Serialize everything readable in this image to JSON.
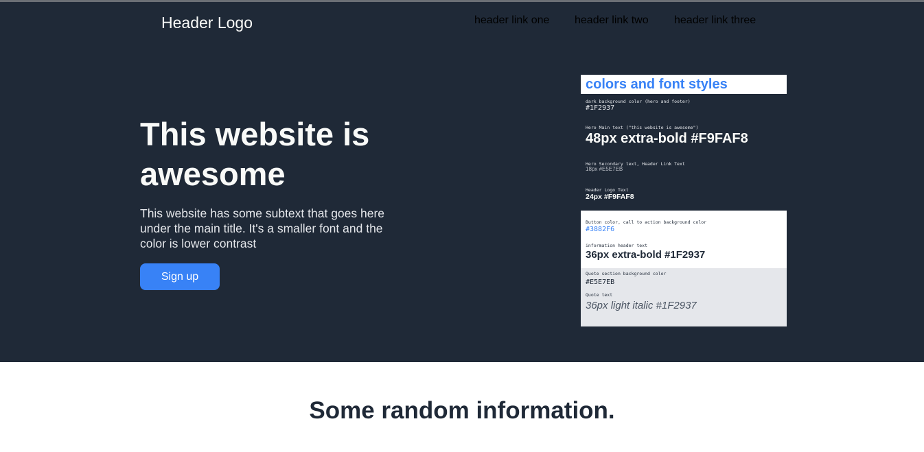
{
  "header": {
    "logo": "Header Logo",
    "links": [
      "header link one",
      "header link two",
      "header link three"
    ]
  },
  "hero": {
    "title": "This website is awesome",
    "subtitle": "This website has some subtext that goes here under the main title. It's a smaller font and the color is lower contrast",
    "cta_label": "Sign up"
  },
  "style_guide": {
    "title": "colors and font styles",
    "items": [
      {
        "label": "dark background color (hero and footer)",
        "value": "#1F2937"
      },
      {
        "label": "Hero Main text (\"this website is awesome\")",
        "value": "48px extra-bold #F9FAF8"
      },
      {
        "label": "Hero Secondary text, Header Link Text",
        "value": "18px #E5E7EB"
      },
      {
        "label": "Header Logo Text",
        "value": "24px #F9FAF8"
      },
      {
        "label": "Button color, call to action background color",
        "value": "#3882F6"
      },
      {
        "label": "information header text",
        "value": "36px extra-bold #1F2937"
      },
      {
        "label": "Quote section background color",
        "value": "#E5E7EB"
      },
      {
        "label": "Quote text",
        "value": "36px light italic #1F2937"
      }
    ]
  },
  "info": {
    "title": "Some random information."
  },
  "colors": {
    "dark_bg": "#1F2937",
    "accent": "#3882F6",
    "hero_text": "#F9FAF8",
    "secondary_text": "#E5E7EB"
  }
}
